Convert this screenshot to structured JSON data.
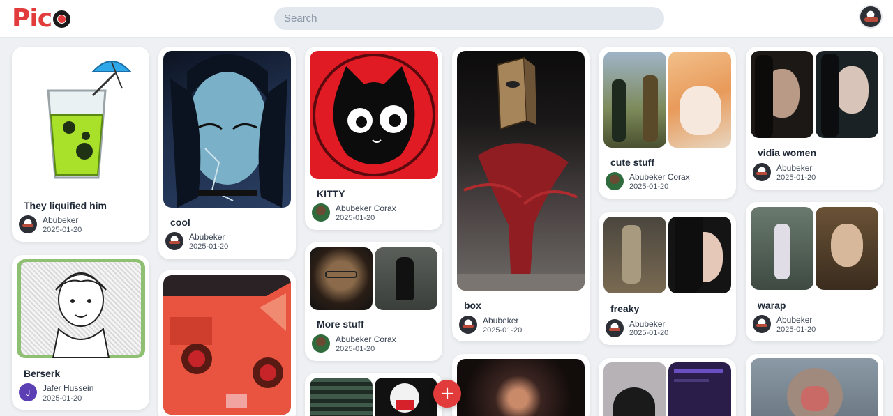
{
  "header": {
    "logo_text": "Pic",
    "search_placeholder": "Search"
  },
  "fab": {
    "label": "+"
  },
  "cards": {
    "liquified": {
      "title": "They liquified him",
      "author": "Abubeker",
      "date": "2025-01-20"
    },
    "cool": {
      "title": "cool",
      "author": "Abubeker",
      "date": "2025-01-20"
    },
    "kitty": {
      "title": "KITTY",
      "author": "Abubeker Corax",
      "date": "2025-01-20"
    },
    "box": {
      "title": "box",
      "author": "Abubeker",
      "date": "2025-01-20"
    },
    "cute_stuff": {
      "title": "cute stuff",
      "author": "Abubeker Corax",
      "date": "2025-01-20"
    },
    "vidia_women": {
      "title": "vidia women",
      "author": "Abubeker",
      "date": "2025-01-20"
    },
    "berserk": {
      "title": "Berserk",
      "author": "Jafer Hussein",
      "author_initial": "J",
      "date": "2025-01-20"
    },
    "more_stuff": {
      "title": "More stuff",
      "author": "Abubeker Corax",
      "date": "2025-01-20"
    },
    "freaky": {
      "title": "freaky",
      "author": "Abubeker",
      "date": "2025-01-20"
    },
    "warap": {
      "title": "warap",
      "author": "Abubeker",
      "date": "2025-01-20"
    }
  }
}
